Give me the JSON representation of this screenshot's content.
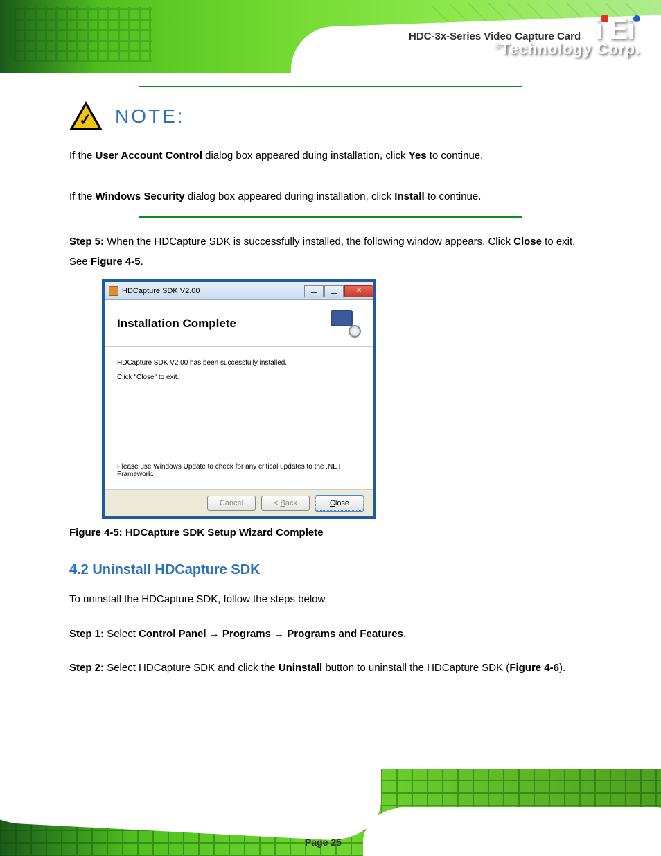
{
  "header": {
    "logo_text": "iEi",
    "tagline": "Technology Corp.",
    "product": "HDC-3x-Series Video Capture Card"
  },
  "note": {
    "label": "NOTE:",
    "body_line1": "If the",
    "body_line2": "User Account Control",
    "body_line3": "dialog box appeared duing installation, click",
    "body_line4": "Yes",
    "body_line5": "to continue.",
    "body_line6_a": "If the",
    "body_line6_b": "Windows Security",
    "body_line6_c": "dialog box appeared during installation, click",
    "body_line6_d": "Install",
    "body_line6_e": "to continue."
  },
  "step": {
    "num_prefix": "Step 5:",
    "text_a": "When the HDCapture SDK is successfully installed, the following window appears. Click",
    "close_label": "Close",
    "text_b": "to exit. See",
    "figure_ref": "Figure 4-5",
    "period": "."
  },
  "dialog": {
    "titlebar": "HDCapture SDK V2.00",
    "heading": "Installation Complete",
    "body_line1": "HDCapture SDK V2.00 has been successfully installed.",
    "body_line2": "Click \"Close\" to exit.",
    "footer_note": "Please use Windows Update to check for any critical updates to the .NET Framework.",
    "btn_cancel": "Cancel",
    "btn_back": "< Back",
    "btn_close": "Close"
  },
  "figure_caption": "Figure 4-5: HDCapture SDK Setup Wizard Complete",
  "uninstall": {
    "heading": "4.2 Uninstall HDCapture SDK",
    "text_a": "To uninstall the HDCapture SDK, follow the steps below.",
    "step1_prefix": "Step 1:",
    "step1_a": "Select",
    "step1_b": "Control Panel",
    "step1_arrow1": "→",
    "step1_c": "Programs",
    "step1_arrow2": "→",
    "step1_d": "Programs and Features",
    "step1_e": ".",
    "step2_prefix": "Step 2:",
    "step2_a": "Select HDCapture SDK and click the",
    "step2_b": "Uninstall",
    "step2_c": "button to uninstall the HDCapture SDK (",
    "step2_fig": "Figure 4-6",
    "step2_d": ")."
  },
  "footer": {
    "page_label": "Page 25",
    "page_number": "25"
  }
}
